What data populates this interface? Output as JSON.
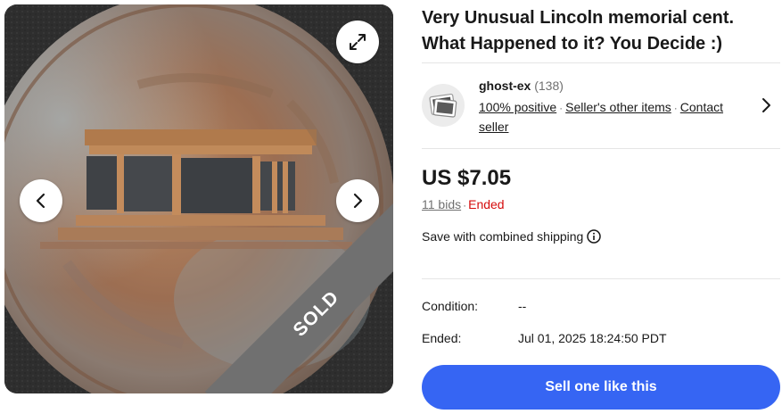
{
  "listing": {
    "title": "Very Unusual Lincoln memorial cent. What Happened to it? You Decide :)",
    "sold_label": "SOLD"
  },
  "seller": {
    "name": "ghost-ex",
    "feedback_count": "(138)",
    "positive": "100% positive",
    "other_items": "Seller's other items",
    "contact": "Contact seller"
  },
  "pricing": {
    "price": "US $7.05",
    "bids": "11 bids",
    "separator": "·",
    "status": "Ended"
  },
  "shipping": {
    "text": "Save with combined shipping"
  },
  "specs": {
    "condition_label": "Condition:",
    "condition_value": "--",
    "ended_label": "Ended:",
    "ended_value": "Jul 01, 2025 18:24:50 PDT"
  },
  "actions": {
    "sell_label": "Sell one like this"
  },
  "colors": {
    "primary_button": "#3665f3",
    "ended_status": "#d50b0b",
    "sold_ribbon": "#707070"
  },
  "icons": {
    "expand": "expand-icon",
    "prev": "chevron-left-icon",
    "next": "chevron-right-icon",
    "info": "info-icon",
    "seller_chevron": "chevron-right-icon"
  }
}
